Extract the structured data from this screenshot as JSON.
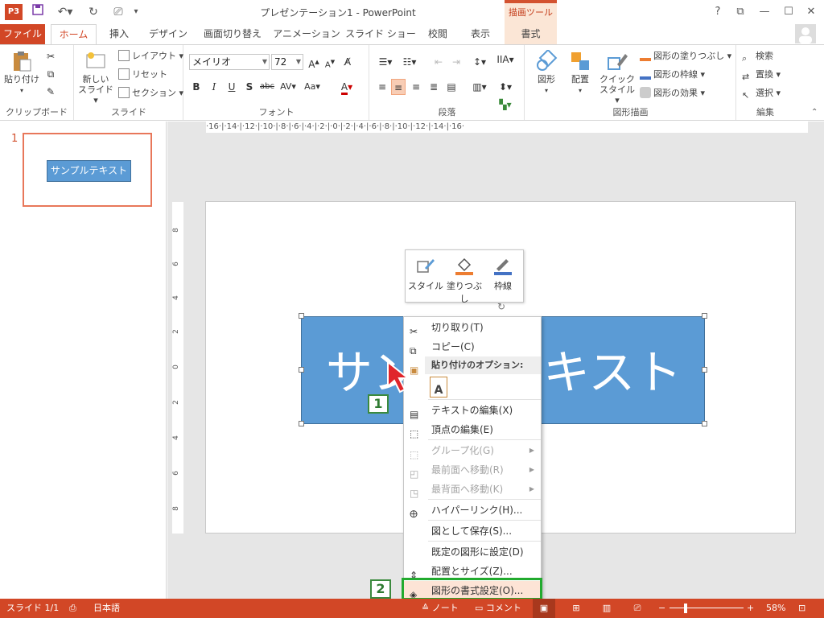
{
  "app": {
    "title": "プレゼンテーション1 - PowerPoint",
    "icon_label": "P3"
  },
  "titlebar": {
    "help": "?",
    "contextual_tool": "描画ツール",
    "window_buttons": [
      "?",
      "⧉",
      "—",
      "☐",
      "✕"
    ]
  },
  "tabs": [
    {
      "label": "ファイル"
    },
    {
      "label": "ホーム"
    },
    {
      "label": "挿入"
    },
    {
      "label": "デザイン"
    },
    {
      "label": "画面切り替え"
    },
    {
      "label": "アニメーション"
    },
    {
      "label": "スライド ショー"
    },
    {
      "label": "校閲"
    },
    {
      "label": "表示"
    },
    {
      "label": "書式"
    }
  ],
  "ribbon": {
    "clipboard": {
      "label": "クリップボード",
      "paste": "貼り付け"
    },
    "slides": {
      "label": "スライド",
      "new_slide_1": "新しい",
      "new_slide_2": "スライド",
      "layout": "レイアウト",
      "reset": "リセット",
      "section": "セクション"
    },
    "font": {
      "label": "フォント",
      "name": "メイリオ",
      "size": "72"
    },
    "paragraph": {
      "label": "段落"
    },
    "drawing": {
      "label": "図形描画",
      "shapes": "図形",
      "arrange": "配置",
      "quick_styles_1": "クイック",
      "quick_styles_2": "スタイル",
      "fill": "図形の塗りつぶし",
      "outline": "図形の枠線",
      "effects": "図形の効果"
    },
    "editing": {
      "label": "編集",
      "find": "検索",
      "replace": "置換",
      "select": "選択"
    }
  },
  "thumbnail": {
    "number": "1",
    "text": "サンプルテキスト"
  },
  "ruler": {
    "h": "·16·|·14·|·12·|·10·|·8·|·6·|·4·|·2·|·0·|·2·|·4·|·6·|·8·|·10·|·12·|·14·|·16·"
  },
  "vruler_ticks": [
    "8",
    "6",
    "4",
    "2",
    "0",
    "2",
    "4",
    "6",
    "8"
  ],
  "shape": {
    "text_left": "サン",
    "text_right": "キスト"
  },
  "mini_toolbar": {
    "style": "スタイル",
    "fill": "塗りつぶし",
    "outline": "枠線"
  },
  "context_menu": {
    "cut": "切り取り(T)",
    "copy": "コピー(C)",
    "paste_options": "貼り付けのオプション:",
    "edit_text": "テキストの編集(X)",
    "edit_points": "頂点の編集(E)",
    "group": "グループ化(G)",
    "bring_front": "最前面へ移動(R)",
    "send_back": "最背面へ移動(K)",
    "hyperlink": "ハイパーリンク(H)...",
    "save_picture": "図として保存(S)...",
    "set_default": "既定の図形に設定(D)",
    "size_position": "配置とサイズ(Z)...",
    "format_shape": "図形の書式設定(O)..."
  },
  "steps": {
    "one": "1",
    "two": "2"
  },
  "statusbar": {
    "slide": "スライド 1/1",
    "language": "日本語",
    "notes": "ノート",
    "comments": "コメント",
    "zoom": "58%"
  },
  "colors": {
    "accent": "#d24726",
    "shape_fill": "#5b9bd5",
    "highlight": "#22aa2e"
  }
}
